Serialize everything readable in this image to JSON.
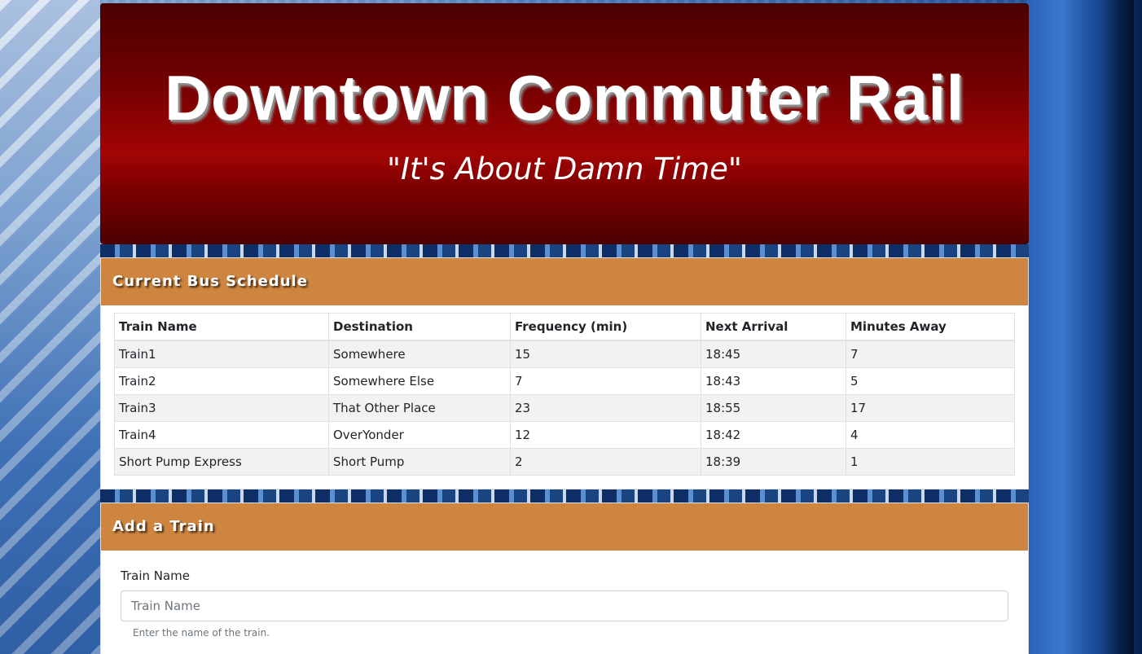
{
  "header": {
    "title": "Downtown Commuter Rail",
    "subtitle": "\"It's About Damn Time\""
  },
  "schedule": {
    "heading": "Current Bus Schedule",
    "columns": [
      "Train Name",
      "Destination",
      "Frequency (min)",
      "Next Arrival",
      "Minutes Away"
    ],
    "rows": [
      [
        "Train1",
        "Somewhere",
        "15",
        "18:45",
        "7"
      ],
      [
        "Train2",
        "Somewhere Else",
        "7",
        "18:43",
        "5"
      ],
      [
        "Train3",
        "That Other Place",
        "23",
        "18:55",
        "17"
      ],
      [
        "Train4",
        "OverYonder",
        "12",
        "18:42",
        "4"
      ],
      [
        "Short Pump Express",
        "Short Pump",
        "2",
        "18:39",
        "1"
      ]
    ]
  },
  "add_train": {
    "heading": "Add a Train",
    "train_name_label": "Train Name",
    "train_name_placeholder": "Train Name",
    "train_name_help": "Enter the name of the train."
  },
  "colors": {
    "jumbotron": "#a30404",
    "card_header": "#cd8540"
  }
}
